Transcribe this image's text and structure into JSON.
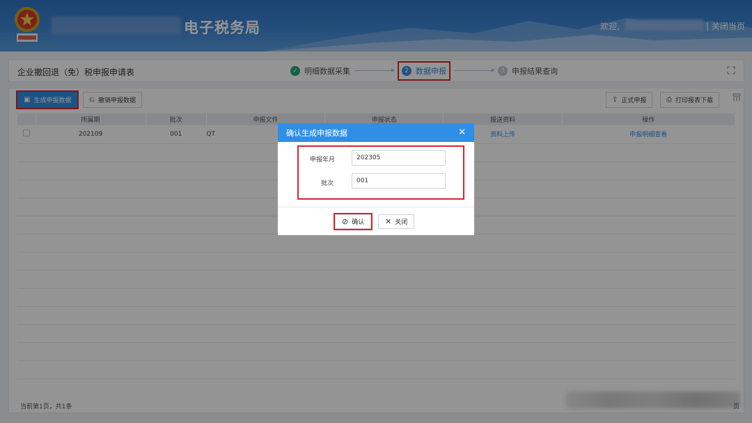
{
  "header": {
    "bureau_name": "电子税务局",
    "welcome": "欢迎,",
    "close_page": "关闭当页"
  },
  "breadcrumb_bar": {
    "page_title": "企业撤回退（免）税申报申请表",
    "steps": [
      {
        "num": "✓",
        "label": "明细数据采集",
        "state": "done"
      },
      {
        "num": "2",
        "label": "数据申报",
        "state": "active"
      },
      {
        "num": "3",
        "label": "申报结果查询",
        "state": "todo"
      }
    ]
  },
  "toolbar": {
    "generate": "生成申报数据",
    "revoke": "撤销申报数据",
    "formal": "正式申报",
    "print": "打印报表下载"
  },
  "table": {
    "headers": [
      "所属期",
      "批次",
      "申报文件",
      "申报状态",
      "报送资料",
      "操作"
    ],
    "rows": [
      {
        "period": "202109",
        "batch": "001",
        "file": "QT",
        "status": "",
        "material": "资料上传",
        "action": "申报明细查看"
      }
    ]
  },
  "footer": {
    "page_info": "当前第1页，共1条",
    "page_suffix": "页"
  },
  "dialog": {
    "title": "确认生成申报数据",
    "month_label": "申报年月",
    "month_value": "202305",
    "batch_label": "批次",
    "batch_value": "001",
    "confirm": "确认",
    "close": "关闭"
  },
  "colors": {
    "primary": "#2f8fe6",
    "header_blue": "#3e86d4",
    "highlight_red": "#d6262a",
    "done_green": "#1aa97a"
  }
}
